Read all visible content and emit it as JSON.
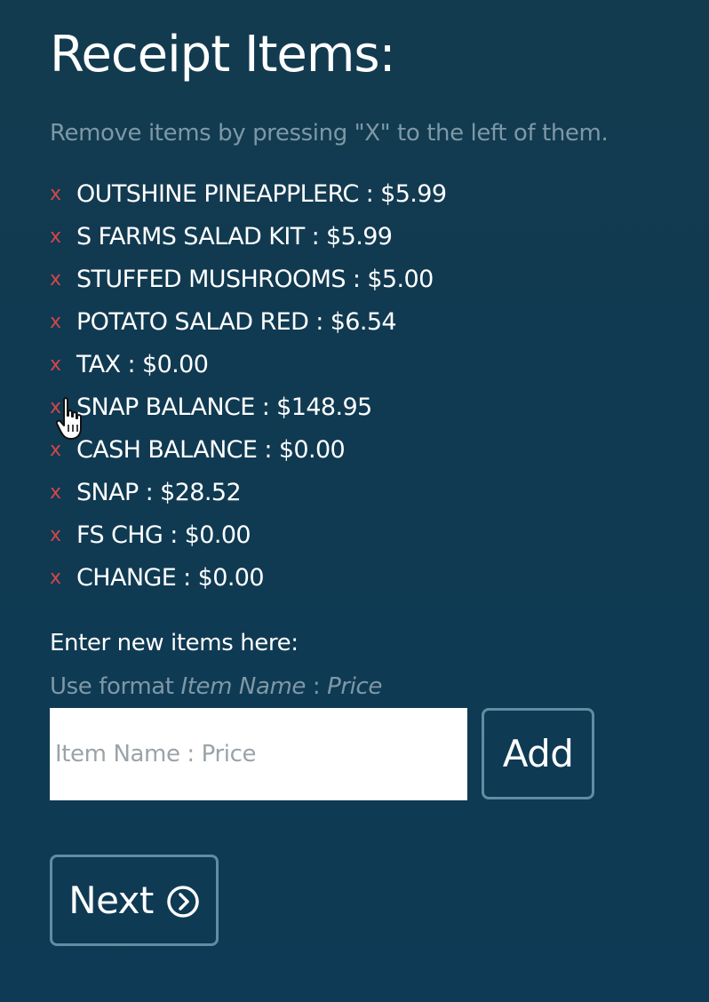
{
  "title": "Receipt Items:",
  "instructions": "Remove items by pressing \"X\" to the left of them.",
  "remove_symbol": "x",
  "items": [
    {
      "label": "OUTSHINE PINEAPPLERC : $5.99"
    },
    {
      "label": "S FARMS SALAD KIT : $5.99"
    },
    {
      "label": "STUFFED MUSHROOMS : $5.00"
    },
    {
      "label": "POTATO SALAD RED : $6.54"
    },
    {
      "label": "TAX : $0.00"
    },
    {
      "label": "SNAP BALANCE : $148.95"
    },
    {
      "label": "CASH BALANCE : $0.00"
    },
    {
      "label": "SNAP : $28.52"
    },
    {
      "label": "FS CHG : $0.00"
    },
    {
      "label": "CHANGE : $0.00"
    }
  ],
  "new_item": {
    "label": "Enter new items here:",
    "hint_prefix": "Use format ",
    "hint_name": "Item Name",
    "hint_sep": " : ",
    "hint_price": "Price",
    "placeholder": "Item Name : Price",
    "value": "",
    "add_label": "Add"
  },
  "next_label": "Next",
  "icons": {
    "next": "chevron-right-circle-icon",
    "cursor": "hand-pointer-icon",
    "remove": "close-icon"
  },
  "colors": {
    "background": "#0f3a52",
    "remove_x": "#d6454b",
    "muted_text": "#7e98a6",
    "button_border": "#5f8ea3"
  }
}
